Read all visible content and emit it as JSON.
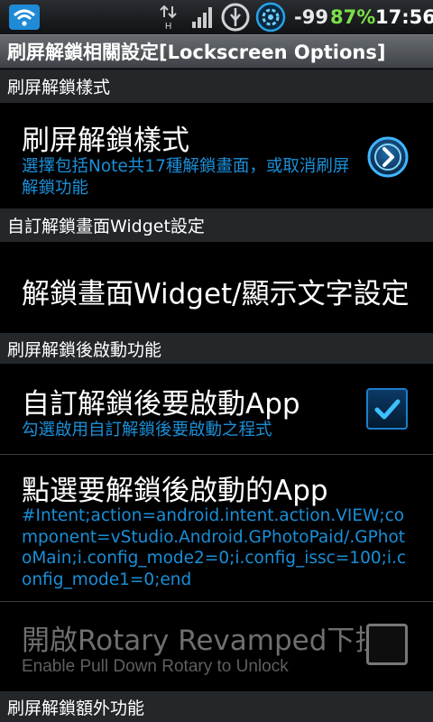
{
  "status_bar": {
    "network": "H",
    "signal_value": "-99",
    "battery": "87%",
    "time": "17:56",
    "battery_color": "#7be14a"
  },
  "title_bar": {
    "text": "刷屏解鎖相關設定[Lockscreen Options]"
  },
  "sections": [
    {
      "label": "刷屏解鎖樣式"
    },
    {
      "label": "自訂解鎖畫面Widget設定"
    },
    {
      "label": "刷屏解鎖後啟動功能"
    },
    {
      "label": "刷屏解鎖額外功能"
    }
  ],
  "items": {
    "lock_style": {
      "title": "刷屏解鎖樣式",
      "summary": "選擇包括Note共17種解鎖畫面，或取消刷屏解鎖功能",
      "icon": "chevron-right-circle-icon"
    },
    "widget_settings": {
      "title": "解鎖畫面Widget/顯示文字設定"
    },
    "custom_app": {
      "title": "自訂解鎖後要啟動App",
      "summary": "勾選啟用自訂解鎖後要啟動之程式",
      "checked": true
    },
    "pick_app": {
      "title": "點選要解鎖後啟動的App",
      "summary": "#Intent;action=android.intent.action.VIEW;component=vStudio.Android.GPhotoPaid/.GPhotoMain;i.config_mode2=0;i.config_issc=100;i.config_mode1=0;end"
    },
    "rotary": {
      "title": "開啟Rotary Revamped下拉",
      "summary": "Enable Pull Down Rotary to Unlock",
      "checked": false,
      "enabled": false
    }
  },
  "colors": {
    "accent": "#1a8fd8",
    "section_bg": "#24272a",
    "disabled_text": "#6f6f6f"
  }
}
